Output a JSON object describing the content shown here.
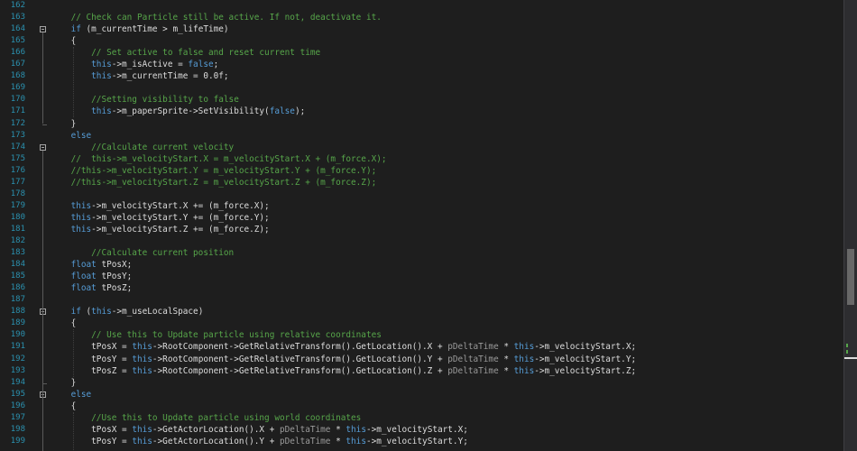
{
  "editor": {
    "lines": [
      {
        "no": "162",
        "segs": []
      },
      {
        "no": "163",
        "segs": [
          {
            "t": "    "
          },
          {
            "t": "// Check can Particle still be active. If not, deactivate it.",
            "c": "cm"
          }
        ]
      },
      {
        "no": "164",
        "segs": [
          {
            "t": "    "
          },
          {
            "t": "if",
            "c": "kw"
          },
          {
            "t": " (m_currentTime > m_lifeTime)"
          }
        ]
      },
      {
        "no": "165",
        "segs": [
          {
            "t": "    {"
          }
        ]
      },
      {
        "no": "166",
        "segs": [
          {
            "t": "        "
          },
          {
            "t": "// Set active to false and reset current time",
            "c": "cm"
          }
        ]
      },
      {
        "no": "167",
        "segs": [
          {
            "t": "        "
          },
          {
            "t": "this",
            "c": "kw"
          },
          {
            "t": "->m_isActive = "
          },
          {
            "t": "false",
            "c": "kw"
          },
          {
            "t": ";"
          }
        ]
      },
      {
        "no": "168",
        "segs": [
          {
            "t": "        "
          },
          {
            "t": "this",
            "c": "kw"
          },
          {
            "t": "->m_currentTime = 0.0f;"
          }
        ]
      },
      {
        "no": "169",
        "segs": []
      },
      {
        "no": "170",
        "segs": [
          {
            "t": "        "
          },
          {
            "t": "//Setting visibility to false",
            "c": "cm"
          }
        ]
      },
      {
        "no": "171",
        "segs": [
          {
            "t": "        "
          },
          {
            "t": "this",
            "c": "kw"
          },
          {
            "t": "->m_paperSprite->SetVisibility("
          },
          {
            "t": "false",
            "c": "kw"
          },
          {
            "t": ");"
          }
        ]
      },
      {
        "no": "172",
        "segs": [
          {
            "t": "    }"
          }
        ]
      },
      {
        "no": "173",
        "segs": [
          {
            "t": "    "
          },
          {
            "t": "else",
            "c": "kw"
          }
        ]
      },
      {
        "no": "174",
        "segs": [
          {
            "t": "        "
          },
          {
            "t": "//Calculate current velocity",
            "c": "cm"
          }
        ]
      },
      {
        "no": "175",
        "segs": [
          {
            "t": "    "
          },
          {
            "t": "//  this->m_velocityStart.X = m_velocityStart.X + (m_force.X);",
            "c": "cm"
          }
        ]
      },
      {
        "no": "176",
        "segs": [
          {
            "t": "    "
          },
          {
            "t": "//this->m_velocityStart.Y = m_velocityStart.Y + (m_force.Y);",
            "c": "cm"
          }
        ]
      },
      {
        "no": "177",
        "segs": [
          {
            "t": "    "
          },
          {
            "t": "//this->m_velocityStart.Z = m_velocityStart.Z + (m_force.Z);",
            "c": "cm"
          }
        ]
      },
      {
        "no": "178",
        "segs": []
      },
      {
        "no": "179",
        "segs": [
          {
            "t": "    "
          },
          {
            "t": "this",
            "c": "kw"
          },
          {
            "t": "->m_velocityStart.X += (m_force.X);"
          }
        ]
      },
      {
        "no": "180",
        "segs": [
          {
            "t": "    "
          },
          {
            "t": "this",
            "c": "kw"
          },
          {
            "t": "->m_velocityStart.Y += (m_force.Y);"
          }
        ]
      },
      {
        "no": "181",
        "segs": [
          {
            "t": "    "
          },
          {
            "t": "this",
            "c": "kw"
          },
          {
            "t": "->m_velocityStart.Z += (m_force.Z);"
          }
        ]
      },
      {
        "no": "182",
        "segs": []
      },
      {
        "no": "183",
        "segs": [
          {
            "t": "        "
          },
          {
            "t": "//Calculate current position",
            "c": "cm"
          }
        ]
      },
      {
        "no": "184",
        "segs": [
          {
            "t": "    "
          },
          {
            "t": "float",
            "c": "kw"
          },
          {
            "t": " tPosX;"
          }
        ]
      },
      {
        "no": "185",
        "segs": [
          {
            "t": "    "
          },
          {
            "t": "float",
            "c": "kw"
          },
          {
            "t": " tPosY;"
          }
        ]
      },
      {
        "no": "186",
        "segs": [
          {
            "t": "    "
          },
          {
            "t": "float",
            "c": "kw"
          },
          {
            "t": " tPosZ;"
          }
        ]
      },
      {
        "no": "187",
        "segs": []
      },
      {
        "no": "188",
        "segs": [
          {
            "t": "    "
          },
          {
            "t": "if",
            "c": "kw"
          },
          {
            "t": " ("
          },
          {
            "t": "this",
            "c": "kw"
          },
          {
            "t": "->m_useLocalSpace)"
          }
        ]
      },
      {
        "no": "189",
        "segs": [
          {
            "t": "    {"
          }
        ]
      },
      {
        "no": "190",
        "segs": [
          {
            "t": "        "
          },
          {
            "t": "// Use this to Update particle using relative coordinates",
            "c": "cm"
          }
        ]
      },
      {
        "no": "191",
        "segs": [
          {
            "t": "        tPosX = "
          },
          {
            "t": "this",
            "c": "kw"
          },
          {
            "t": "->RootComponent->GetRelativeTransform().GetLocation().X + "
          },
          {
            "t": "pDeltaTime",
            "c": "pm"
          },
          {
            "t": " * "
          },
          {
            "t": "this",
            "c": "kw"
          },
          {
            "t": "->m_velocityStart.X;"
          }
        ]
      },
      {
        "no": "192",
        "segs": [
          {
            "t": "        tPosY = "
          },
          {
            "t": "this",
            "c": "kw"
          },
          {
            "t": "->RootComponent->GetRelativeTransform().GetLocation().Y + "
          },
          {
            "t": "pDeltaTime",
            "c": "pm"
          },
          {
            "t": " * "
          },
          {
            "t": "this",
            "c": "kw"
          },
          {
            "t": "->m_velocityStart.Y;"
          }
        ]
      },
      {
        "no": "193",
        "segs": [
          {
            "t": "        tPosZ = "
          },
          {
            "t": "this",
            "c": "kw"
          },
          {
            "t": "->RootComponent->GetRelativeTransform().GetLocation().Z + "
          },
          {
            "t": "pDeltaTime",
            "c": "pm"
          },
          {
            "t": " * "
          },
          {
            "t": "this",
            "c": "kw"
          },
          {
            "t": "->m_velocityStart.Z;"
          }
        ]
      },
      {
        "no": "194",
        "segs": [
          {
            "t": "    }"
          }
        ]
      },
      {
        "no": "195",
        "segs": [
          {
            "t": "    "
          },
          {
            "t": "else",
            "c": "kw"
          }
        ]
      },
      {
        "no": "196",
        "segs": [
          {
            "t": "    {"
          }
        ]
      },
      {
        "no": "197",
        "segs": [
          {
            "t": "        "
          },
          {
            "t": "//Use this to Update particle using world coordinates",
            "c": "cm"
          }
        ]
      },
      {
        "no": "198",
        "segs": [
          {
            "t": "        tPosX = "
          },
          {
            "t": "this",
            "c": "kw"
          },
          {
            "t": "->GetActorLocation().X + "
          },
          {
            "t": "pDeltaTime",
            "c": "pm"
          },
          {
            "t": " * "
          },
          {
            "t": "this",
            "c": "kw"
          },
          {
            "t": "->m_velocityStart.X;"
          }
        ]
      },
      {
        "no": "199",
        "segs": [
          {
            "t": "        tPosY = "
          },
          {
            "t": "this",
            "c": "kw"
          },
          {
            "t": "->GetActorLocation().Y + "
          },
          {
            "t": "pDeltaTime",
            "c": "pm"
          },
          {
            "t": " * "
          },
          {
            "t": "this",
            "c": "kw"
          },
          {
            "t": "->m_velocityStart.Y;"
          }
        ]
      }
    ]
  },
  "colors": {
    "background": "#1e1e1e",
    "keyword": "#569cd6",
    "comment": "#57a64a",
    "plain": "#dcdcdc",
    "line_number": "#2b91af",
    "parameter": "#9a9a9a"
  }
}
